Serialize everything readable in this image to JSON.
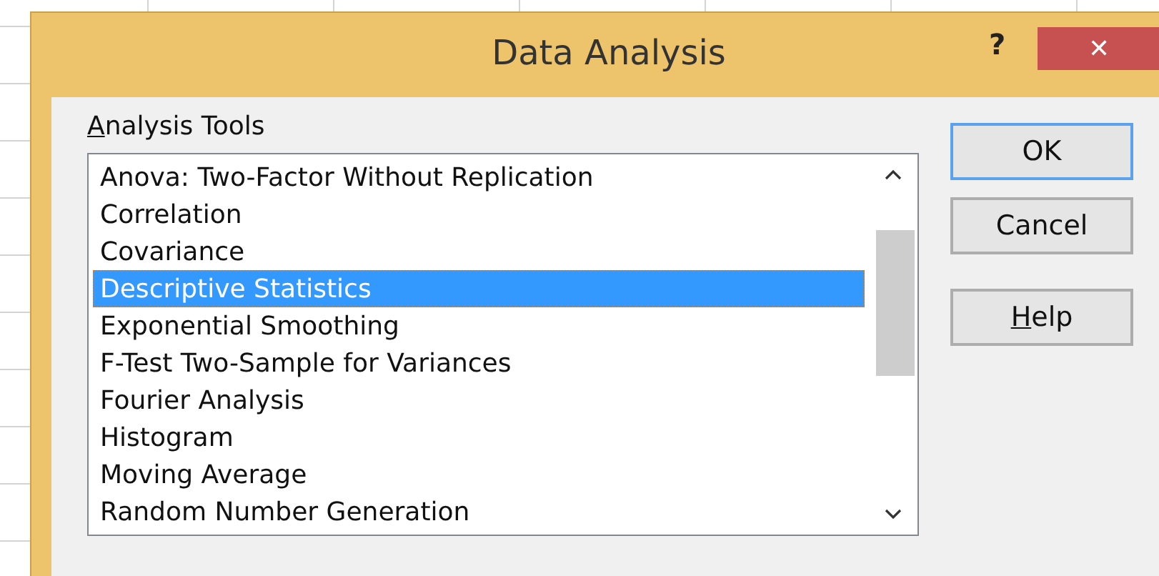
{
  "window": {
    "title": "Data Analysis",
    "help_glyph": "?",
    "close_glyph": "✕"
  },
  "list": {
    "label": "Analysis Tools",
    "label_underline_first": true,
    "items": [
      {
        "label": "Anova: Two-Factor Without Replication",
        "selected": false
      },
      {
        "label": "Correlation",
        "selected": false
      },
      {
        "label": "Covariance",
        "selected": false
      },
      {
        "label": "Descriptive Statistics",
        "selected": true
      },
      {
        "label": "Exponential Smoothing",
        "selected": false
      },
      {
        "label": "F-Test Two-Sample for Variances",
        "selected": false
      },
      {
        "label": "Fourier Analysis",
        "selected": false
      },
      {
        "label": "Histogram",
        "selected": false
      },
      {
        "label": "Moving Average",
        "selected": false
      },
      {
        "label": "Random Number Generation",
        "selected": false
      }
    ]
  },
  "buttons": [
    {
      "label": "OK",
      "default": true
    },
    {
      "label": "Cancel",
      "default": false
    },
    {
      "label": "Help",
      "default": false,
      "underline_first": true
    }
  ]
}
